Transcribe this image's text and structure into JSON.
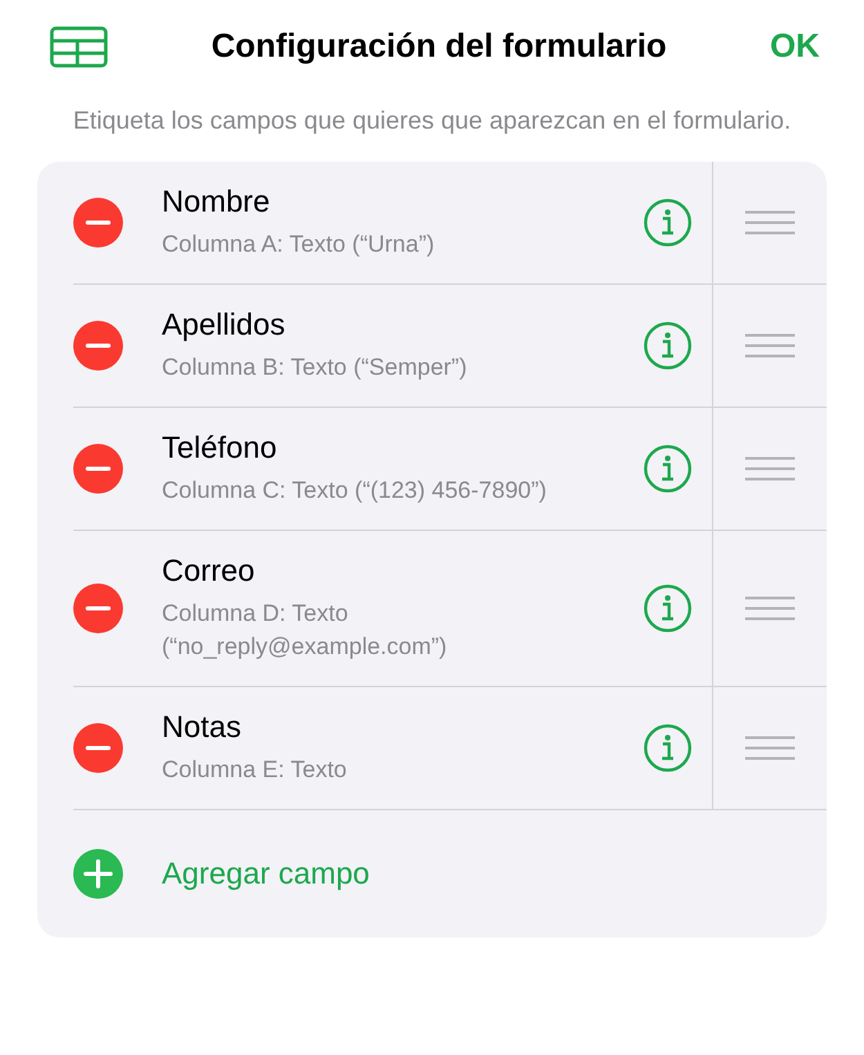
{
  "header": {
    "title": "Configuración del formulario",
    "done": "OK"
  },
  "description": "Etiqueta los campos que quieres que aparezcan en el formulario.",
  "fields": [
    {
      "name": "Nombre",
      "detail": "Columna A: Texto (“Urna”)"
    },
    {
      "name": "Apellidos",
      "detail": "Columna B: Texto (“Semper”)"
    },
    {
      "name": "Teléfono",
      "detail": "Columna C: Texto (“(123) 456-7890”)"
    },
    {
      "name": "Correo",
      "detail": "Columna D: Texto (“no_reply@example.com”)"
    },
    {
      "name": "Notas",
      "detail": "Columna E: Texto"
    }
  ],
  "add_field": "Agregar campo"
}
